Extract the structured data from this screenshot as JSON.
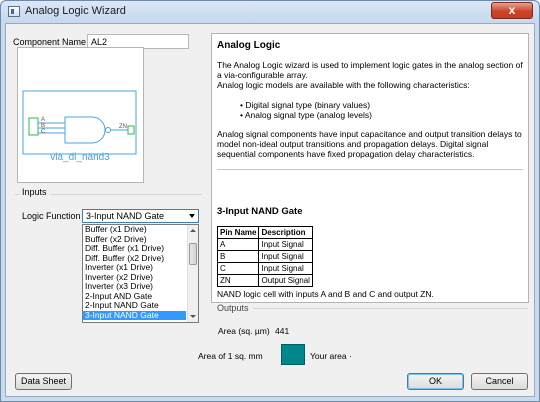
{
  "window": {
    "title": "Analog Logic Wizard",
    "close_glyph": "x"
  },
  "form": {
    "component_name_label": "Component Name",
    "component_name_value": "AL2",
    "inputs_group_label": "Inputs",
    "logic_function_label": "Logic Function",
    "logic_function_value": "3-Input NAND Gate",
    "logic_function_options": [
      "Buffer (x1 Drive)",
      "Buffer (x2 Drive)",
      "Diff. Buffer (x1 Drive)",
      "Diff. Buffer (x2 Drive)",
      "Inverter (x1 Drive)",
      "Inverter (x2 Drive)",
      "Inverter (x3 Drive)",
      "2-Input AND Gate",
      "2-Input NAND Gate",
      "3-Input NAND Gate"
    ],
    "selected_option_index": 9
  },
  "preview": {
    "cell_name": "via_dl_nand3",
    "pins_in": [
      "A",
      "B",
      "C"
    ],
    "pin_out": "ZN",
    "stroke_color": "#4aa3df",
    "pin_color": "#2fb84a"
  },
  "description": {
    "title": "Analog Logic",
    "intro": "The Analog Logic wizard is used to implement logic gates in the analog section of a via-configurable array.",
    "models_intro": "Analog logic models are available with the following characteristics:",
    "bullets": [
      "Digital signal type (binary values)",
      "Analog signal type (analog levels)"
    ],
    "details": "Analog signal components have input capacitance and output transition delays to model non-ideal output transitions and propagation delays. Digital signal sequential components have fixed propagation delay characteristics.",
    "gate_title": "3-Input NAND Gate",
    "pin_table": {
      "headers": [
        "Pin Name",
        "Description"
      ],
      "rows": [
        [
          "A",
          "Input Signal"
        ],
        [
          "B",
          "Input Signal"
        ],
        [
          "C",
          "Input Signal"
        ],
        [
          "ZN",
          "Output Signal"
        ]
      ]
    },
    "gate_summary": "NAND logic cell with inputs A and B and C and output ZN."
  },
  "outputs": {
    "group_label": "Outputs",
    "area_label": "Area (sq. µm)",
    "area_value": "441"
  },
  "area_compare": {
    "sq_mm_label": "Area of 1 sq. mm",
    "swatch_color": "#00868b",
    "your_area_label": "Your area",
    "your_area_marker": "·"
  },
  "buttons": {
    "data_sheet": "Data Sheet",
    "ok": "OK",
    "cancel": "Cancel"
  }
}
